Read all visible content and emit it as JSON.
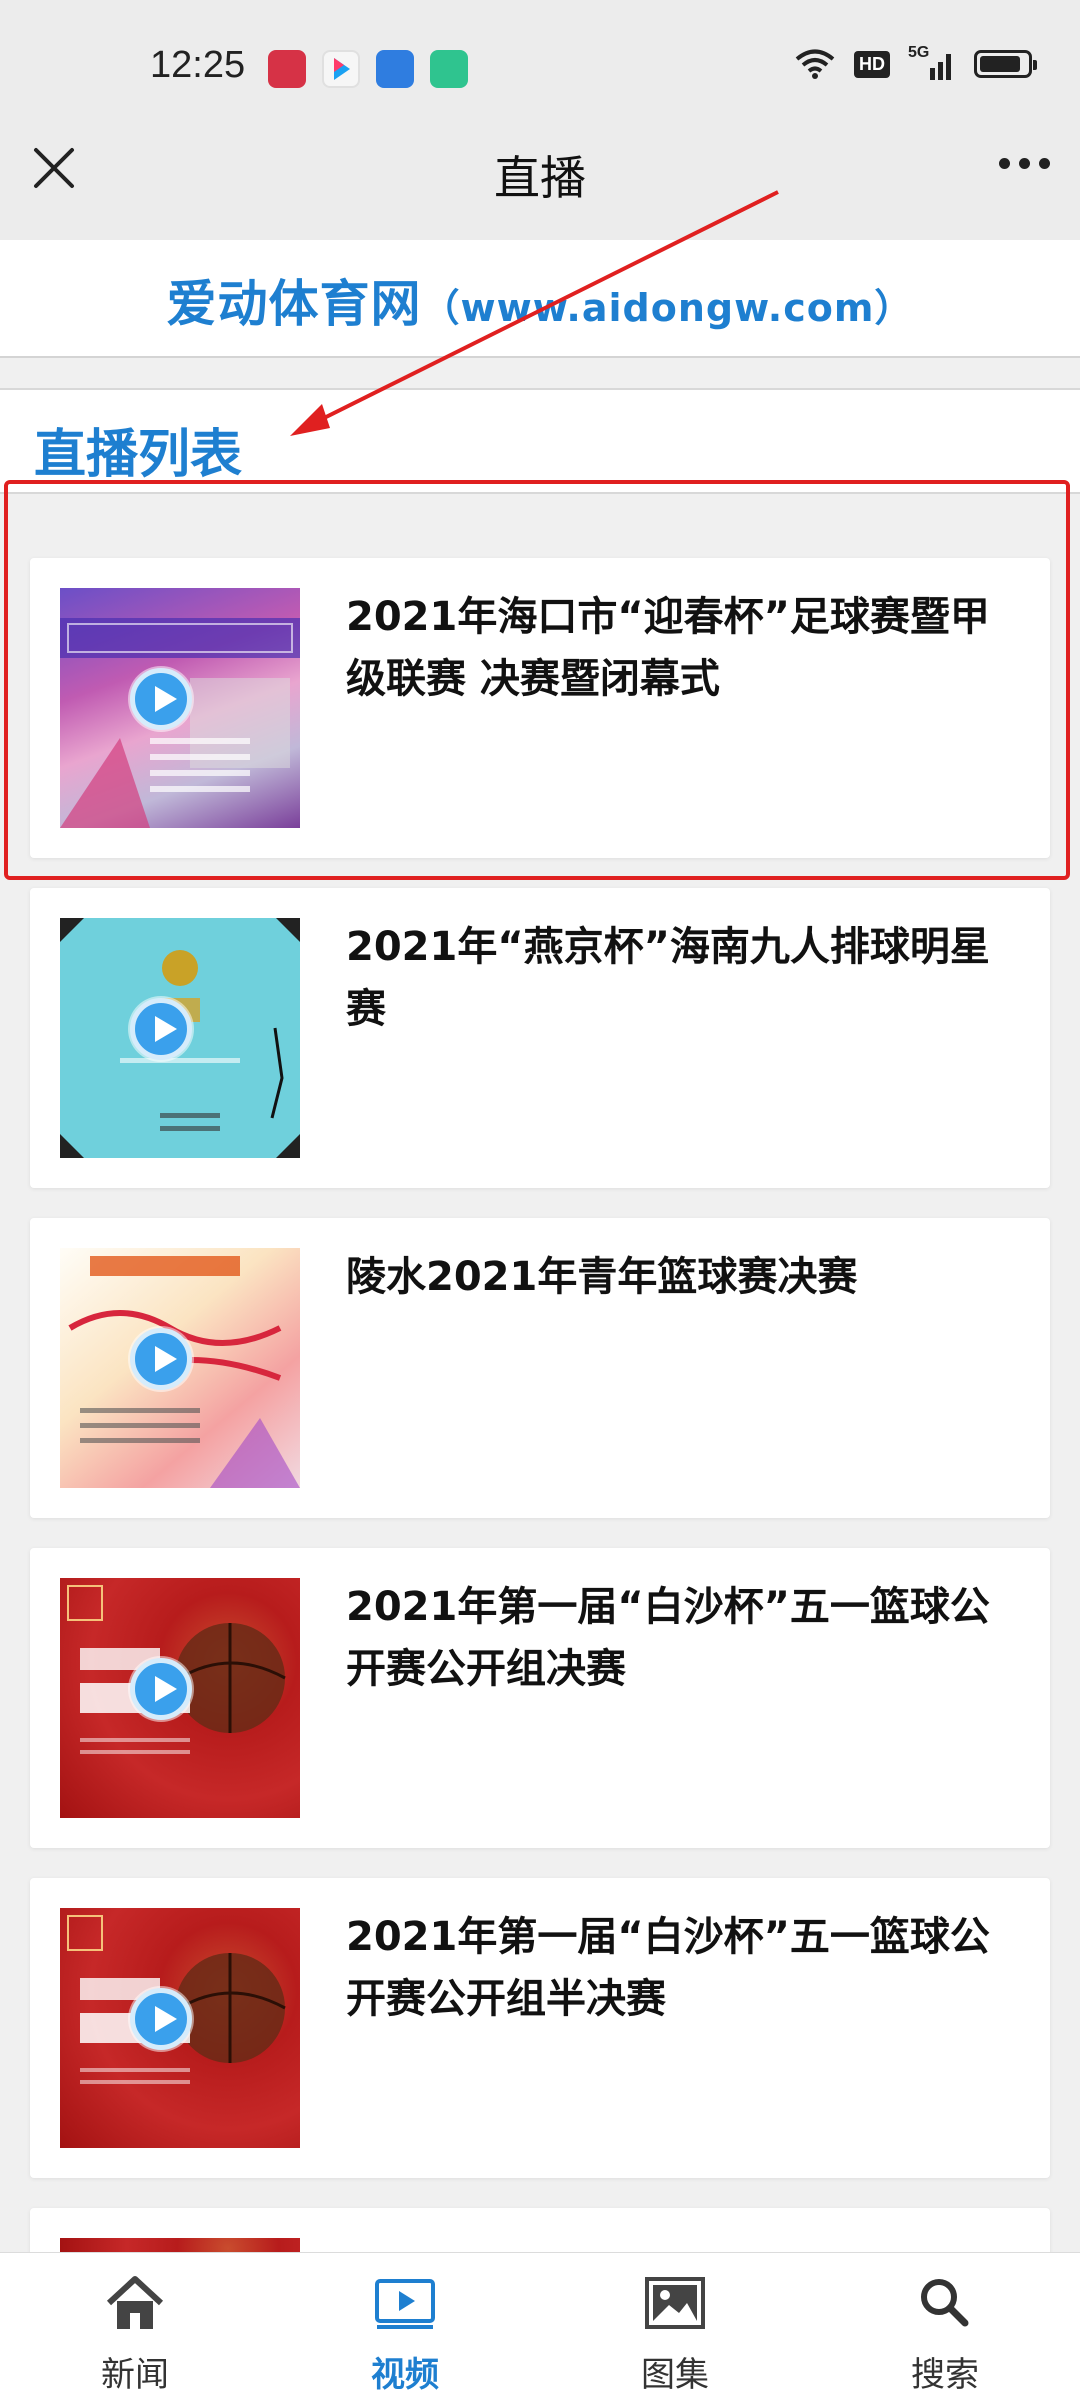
{
  "status_bar": {
    "time": "12:25",
    "network": "5G",
    "hd": "HD",
    "app_icons": [
      "multi-app-icon",
      "youku-icon",
      "chat-bubble-icon",
      "window-app-icon"
    ]
  },
  "nav": {
    "title": "直播",
    "close_icon": "close-icon",
    "more_icon": "more-dots-icon"
  },
  "site": {
    "name": "爱动体育网",
    "url": "（www.aidongw.com）"
  },
  "list_heading": "直播列表",
  "items": [
    {
      "title": "2021年海口市“迎春杯”足球赛暨甲级联赛 决赛暨闭幕式"
    },
    {
      "title": "2021年“燕京杯”海南九人排球明星赛"
    },
    {
      "title": "陵水2021年青年篮球赛决赛"
    },
    {
      "title": "2021年第一届“白沙杯”五一篮球公开赛公开组决赛"
    },
    {
      "title": "2021年第一届“白沙杯”五一篮球公开赛公开组半决赛"
    }
  ],
  "tabs": [
    {
      "label": "新闻",
      "icon": "home-icon",
      "active": false
    },
    {
      "label": "视频",
      "icon": "video-icon",
      "active": true
    },
    {
      "label": "图集",
      "icon": "gallery-icon",
      "active": false
    },
    {
      "label": "搜索",
      "icon": "search-icon",
      "active": false
    }
  ],
  "colors": {
    "accent": "#1e7fd0",
    "annotation": "#e02020",
    "play_button": "#3aa0ec"
  }
}
